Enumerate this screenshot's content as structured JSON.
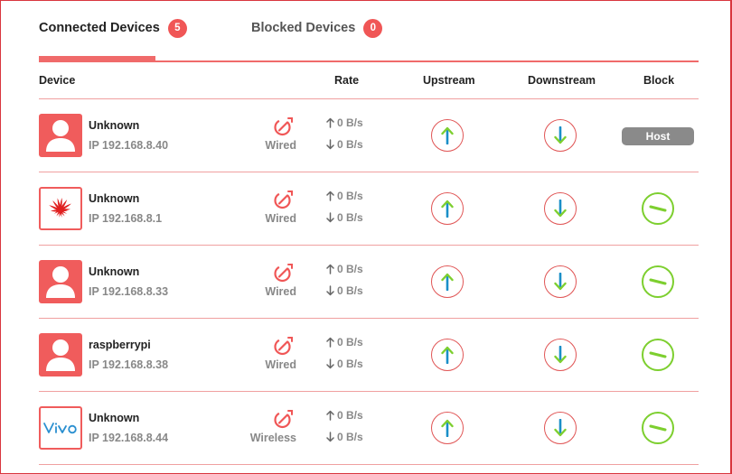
{
  "tabs": [
    {
      "label": "Connected Devices",
      "count": "5"
    },
    {
      "label": "Blocked Devices",
      "count": "0"
    }
  ],
  "columns": {
    "device": "Device",
    "rate": "Rate",
    "upstream": "Upstream",
    "downstream": "Downstream",
    "block": "Block"
  },
  "devices": [
    {
      "name": "Unknown",
      "ip": "IP 192.168.8.40",
      "connection": "Wired",
      "rate_up": "0 B/s",
      "rate_down": "0 B/s",
      "avatar": "person-icon",
      "block": "Host"
    },
    {
      "name": "Unknown",
      "ip": "IP 192.168.8.1",
      "connection": "Wired",
      "rate_up": "0 B/s",
      "rate_down": "0 B/s",
      "avatar": "huawei-logo-icon",
      "block": ""
    },
    {
      "name": "Unknown",
      "ip": "IP 192.168.8.33",
      "connection": "Wired",
      "rate_up": "0 B/s",
      "rate_down": "0 B/s",
      "avatar": "person-icon",
      "block": ""
    },
    {
      "name": "raspberrypi",
      "ip": "IP 192.168.8.38",
      "connection": "Wired",
      "rate_up": "0 B/s",
      "rate_down": "0 B/s",
      "avatar": "person-icon",
      "block": ""
    },
    {
      "name": "Unknown",
      "ip": "IP 192.168.8.44",
      "connection": "Wireless",
      "rate_up": "0 B/s",
      "rate_down": "0 B/s",
      "avatar": "vivo-logo-icon",
      "block": ""
    }
  ],
  "colors": {
    "accent": "#f05656",
    "arrow_green": "#7dcf2f",
    "arrow_blue": "#1a8fc8",
    "host_gray": "#8a8a8a"
  }
}
